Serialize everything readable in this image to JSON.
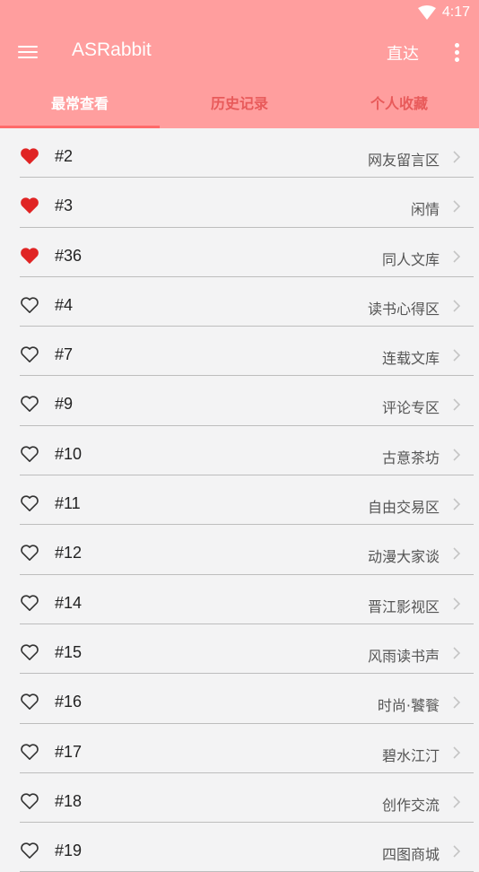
{
  "status": {
    "time": "4:17"
  },
  "appbar": {
    "title": "ASRabbit",
    "action": "直达"
  },
  "tabs": [
    {
      "label": "最常查看",
      "active": true
    },
    {
      "label": "历史记录",
      "active": false
    },
    {
      "label": "个人收藏",
      "active": false
    }
  ],
  "colors": {
    "appbar": "#ff9e9e",
    "heart_filled": "#e02424",
    "tab_inactive": "#e85a5a"
  },
  "rows": [
    {
      "num": "#2",
      "label": "网友留言区",
      "fav": true
    },
    {
      "num": "#3",
      "label": "闲情",
      "fav": true
    },
    {
      "num": "#36",
      "label": "同人文库",
      "fav": true
    },
    {
      "num": "#4",
      "label": "读书心得区",
      "fav": false
    },
    {
      "num": "#7",
      "label": "连载文库",
      "fav": false
    },
    {
      "num": "#9",
      "label": "评论专区",
      "fav": false
    },
    {
      "num": "#10",
      "label": "古意茶坊",
      "fav": false
    },
    {
      "num": "#11",
      "label": "自由交易区",
      "fav": false
    },
    {
      "num": "#12",
      "label": "动漫大家谈",
      "fav": false
    },
    {
      "num": "#14",
      "label": "晋江影视区",
      "fav": false
    },
    {
      "num": "#15",
      "label": "风雨读书声",
      "fav": false
    },
    {
      "num": "#16",
      "label": "时尚·饕餮",
      "fav": false
    },
    {
      "num": "#17",
      "label": "碧水江汀",
      "fav": false
    },
    {
      "num": "#18",
      "label": "创作交流",
      "fav": false
    },
    {
      "num": "#19",
      "label": "四图商城",
      "fav": false
    }
  ]
}
